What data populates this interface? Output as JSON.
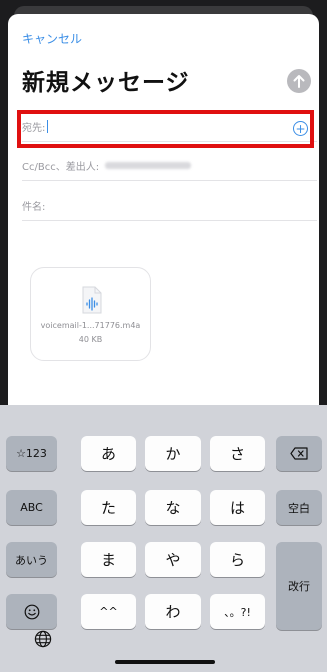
{
  "compose": {
    "cancel_label": "キャンセル",
    "title": "新規メッセージ",
    "to_label": "宛先:",
    "cc_label": "Cc/Bcc、差出人:",
    "subject_label": "件名:"
  },
  "attachment": {
    "name": "voicemail-1...71776.m4a",
    "size": "40 KB"
  },
  "keyboard": {
    "row1": [
      "☆123",
      "あ",
      "か",
      "さ"
    ],
    "row2": [
      "ABC",
      "た",
      "な",
      "は",
      "空白"
    ],
    "row3": [
      "あいう",
      "ま",
      "や",
      "ら",
      "改行"
    ],
    "row4": [
      "^^",
      "わ",
      "、。?!"
    ]
  },
  "colors": {
    "accent": "#3b8ee6",
    "highlight": "#e01010"
  }
}
